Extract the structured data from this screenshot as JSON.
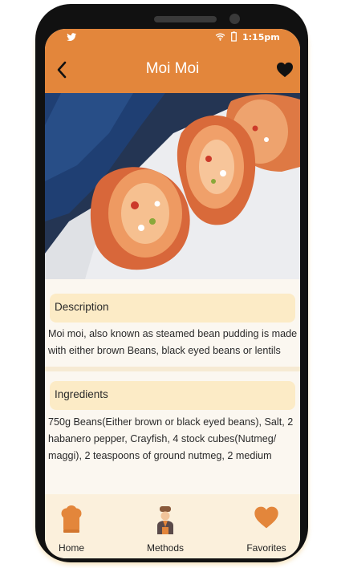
{
  "status_bar": {
    "time": "1:15pm"
  },
  "header": {
    "title": "Moi Moi"
  },
  "description": {
    "heading": "Description",
    "lines": [
      "Moi moi, also known as steamed bean pudding is made",
      "with either brown Beans, black eyed beans or lentils"
    ]
  },
  "ingredients": {
    "heading": "Ingredients",
    "lines": [
      "750g Beans(Either brown or black eyed beans), Salt, 2",
      "habanero pepper, Crayfish, 4 stock cubes(Nutmeg/",
      "maggi), 2 teaspoons of ground nutmeg, 2 medium"
    ]
  },
  "bottom_nav": {
    "home_label": "Home",
    "methods_label": "Methods",
    "favorites_label": "Favorites"
  },
  "colors": {
    "accent": "#e3863b",
    "card": "#fcebc6",
    "nav_background": "#fbf0dc"
  },
  "icons": [
    "twitter-icon",
    "wifi-icon",
    "battery-icon",
    "back-arrow-icon",
    "heart-icon",
    "chef-hat-icon",
    "chef-icon",
    "heart-icon"
  ]
}
